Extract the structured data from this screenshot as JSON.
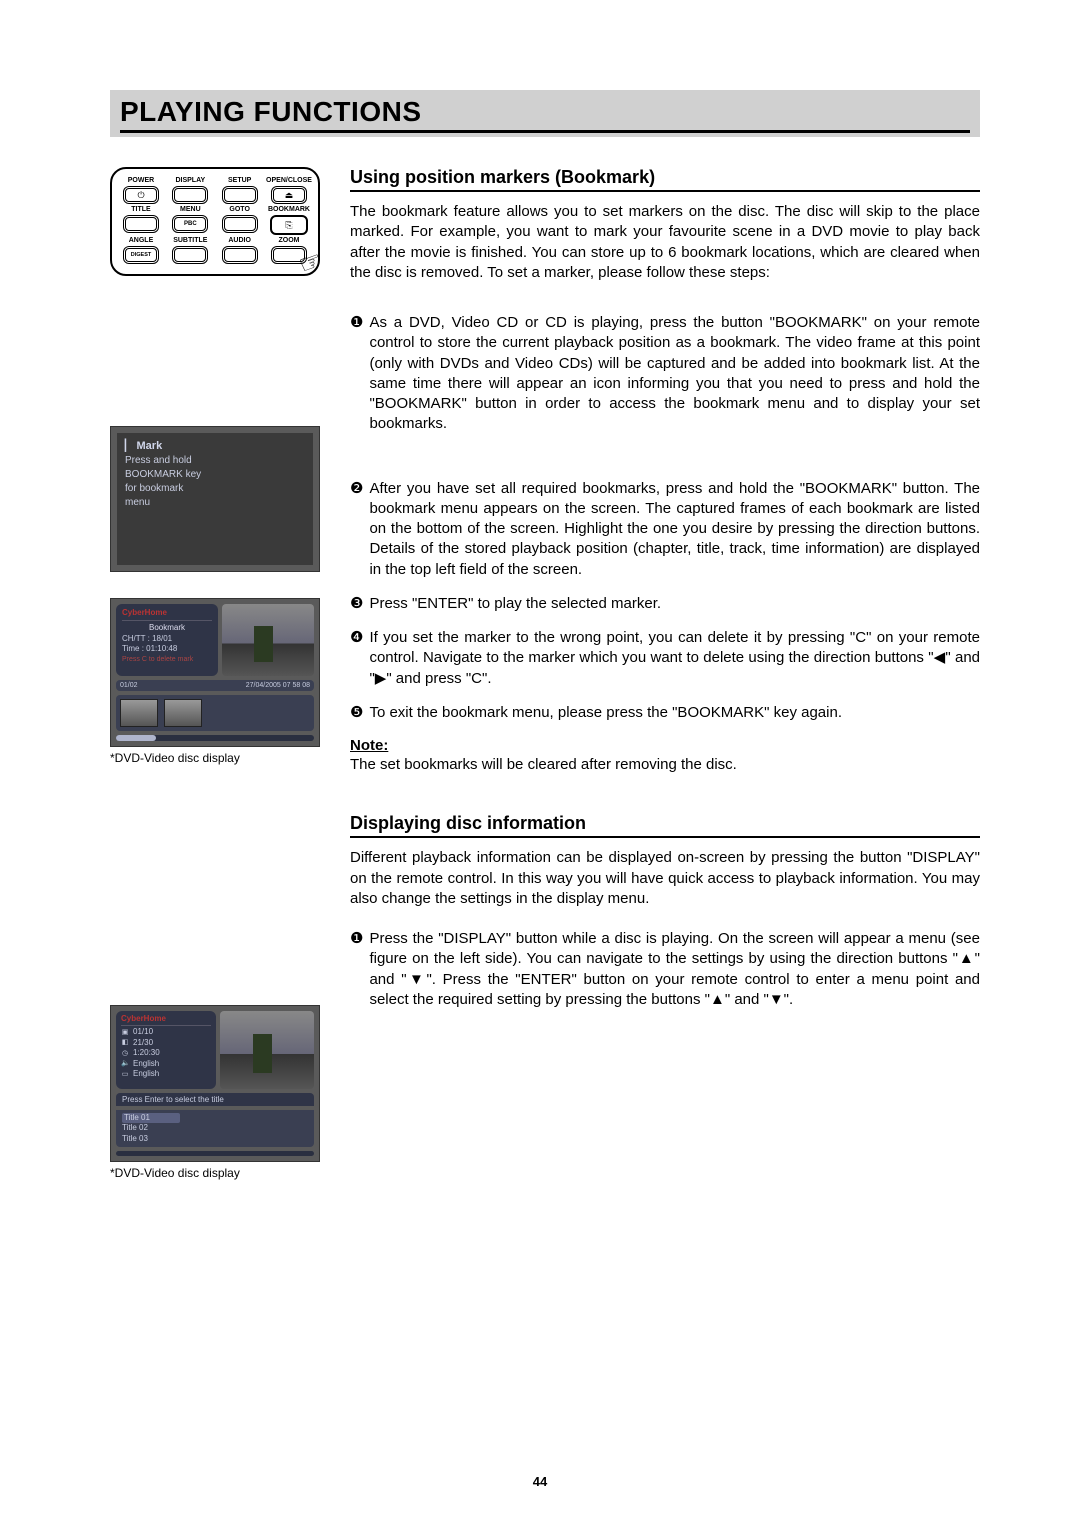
{
  "page_title": "PLAYING FUNCTIONS",
  "page_number": "44",
  "remote": {
    "rows": [
      [
        "POWER",
        "DISPLAY",
        "SETUP",
        "OPEN/CLOSE"
      ],
      [
        "TITLE",
        "MENU",
        "GOTO",
        "BOOKMARK"
      ],
      [
        "ANGLE",
        "SUBTITLE",
        "AUDIO",
        "ZOOM"
      ]
    ],
    "row2_sub": "PBC",
    "row3_sub": "DIGEST",
    "power_glyph": "⏻",
    "eject_glyph": "⏏",
    "bookmark_glyph": "⎘"
  },
  "osd_mark": {
    "title": "Mark",
    "line1": "Press and hold",
    "line2": "BOOKMARK key",
    "line3": "for bookmark",
    "line4": "menu"
  },
  "osd_bm": {
    "brand": "CyberHome",
    "label": "Bookmark",
    "chtt": "CH/TT : 18/01",
    "time": "Time : 01:10:48",
    "hint": "Press C to delete mark",
    "counter": "01/02",
    "timestamp": "27/04/2005 07 58 08"
  },
  "caption1": "*DVD-Video disc display",
  "osd_disp": {
    "brand": "CyberHome",
    "r1": "01/10",
    "r2": "21/30",
    "r3": "1:20:30",
    "r4": "English",
    "r5": "English",
    "select_hint": "Press Enter to select the title",
    "t1": "Title 01",
    "t2": "Title 02",
    "t3": "Title 03"
  },
  "caption2": "*DVD-Video disc display",
  "section1": {
    "heading": "Using position markers (Bookmark)",
    "intro": "The bookmark feature allows you to set markers on the disc. The disc will skip to the place marked. For example, you want to mark your favourite scene in a DVD movie to play back after the movie is finished. You can store up to 6 bookmark locations, which are cleared when the disc is removed. To set a marker, please follow these steps:",
    "step1": "As a DVD, Video CD or CD is playing, press the button \"BOOKMARK\" on your remote control to store the current playback position as a bookmark. The video frame at this point (only with DVDs and Video CDs) will be captured and be added into bookmark list. At the same time there will appear an icon informing you that you need to press and hold the \"BOOKMARK\" button in order to access the bookmark menu and to display your set bookmarks.",
    "step2": "After you have set all required bookmarks, press and hold the \"BOOKMARK\" button. The bookmark menu appears on the screen. The captured frames of each bookmark are listed on the bottom of the screen. Highlight the one you desire by pressing the direction buttons. Details of the stored playback position (chapter, title, track, time information) are displayed in the top left field of the screen.",
    "step3": "Press \"ENTER\" to play the selected marker.",
    "step4": "If you set the marker to the wrong point, you can delete it by pressing \"C\" on your remote control. Navigate to the marker which you want to delete using the direction buttons \"◀\" and \"▶\" and press \"C\".",
    "step5": "To exit the bookmark menu, please press the \"BOOKMARK\" key again.",
    "note_label": "Note:",
    "note_text": "The set bookmarks will be cleared after removing the disc."
  },
  "section2": {
    "heading": "Displaying disc information",
    "intro": "Different playback information can be displayed on-screen by pressing the button \"DISPLAY\" on the remote control. In this way you will have quick access to playback information. You may also change the settings in the display menu.",
    "step1": "Press the \"DISPLAY\" button while a disc is playing. On the screen will appear a menu (see figure on the left side). You can navigate to the settings by using the direction buttons \"▲\" and \"▼\". Press the \"ENTER\" button on your remote control to enter a menu point and select the required setting by pressing the buttons \"▲\" and \"▼\"."
  },
  "bullets": {
    "n1": "❶",
    "n2": "❷",
    "n3": "❸",
    "n4": "❹",
    "n5": "❺"
  }
}
